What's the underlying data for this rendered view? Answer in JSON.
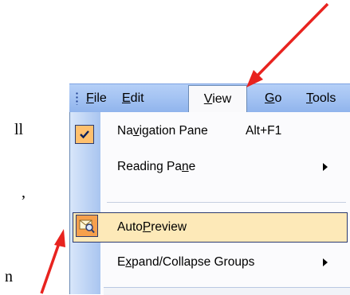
{
  "background_text": {
    "line1": "ll",
    "line2": ",",
    "line3": "n"
  },
  "menubar": {
    "file": {
      "mnemonic": "F",
      "rest": "ile"
    },
    "edit": {
      "mnemonic": "E",
      "rest": "dit"
    },
    "view": {
      "mnemonic": "V",
      "rest": "iew"
    },
    "go": {
      "mnemonic": "G",
      "rest": "o"
    },
    "tools": {
      "mnemonic": "T",
      "rest": "ools"
    }
  },
  "view_menu": {
    "navigation_pane": {
      "before": "Na",
      "mnemonic": "v",
      "after": "igation Pane",
      "shortcut": "Alt+F1",
      "checked": true
    },
    "reading_pane": {
      "before": "Reading Pa",
      "mnemonic": "n",
      "after": "e"
    },
    "autopreview": {
      "before": "Auto",
      "mnemonic": "P",
      "after": "review",
      "highlighted": true
    },
    "expand_collapse": {
      "before": "E",
      "mnemonic": "x",
      "after": "pand/Collapse Groups"
    }
  },
  "colors": {
    "annotation_arrow": "#e8231f",
    "highlight": "#fde9b8",
    "menubar": "#a5c4f3"
  },
  "icons": {
    "checkmark": "checkmark-icon",
    "autopreview": "autopreview-envelope-icon",
    "submenu": "submenu-arrow-icon"
  }
}
